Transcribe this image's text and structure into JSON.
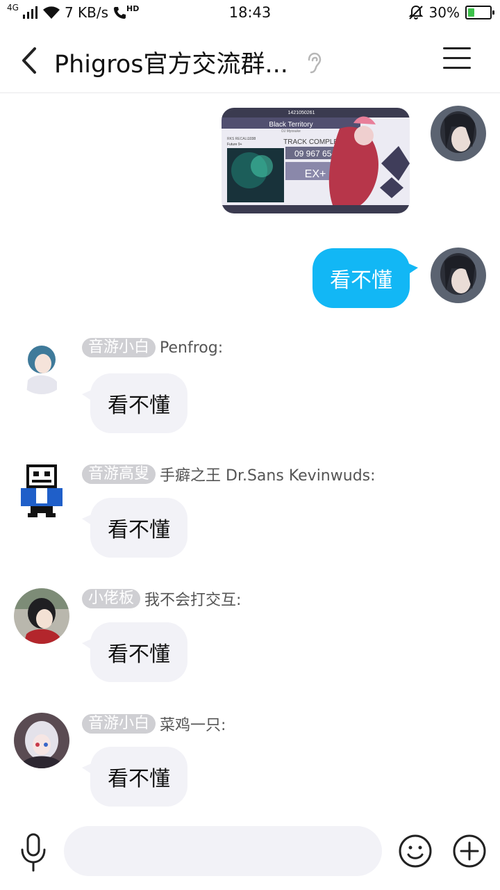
{
  "status_bar": {
    "network": "4G",
    "speed": "7 KB/s",
    "call_badge": "HD",
    "time": "18:43",
    "battery": "30%",
    "battery_level": 0.3
  },
  "header": {
    "title": "Phigros官方交流群...",
    "back_icon": "back-chevron-icon",
    "ear_icon": "earpiece-icon",
    "menu_icon": "menu-icon"
  },
  "messages": {
    "image_card": {
      "id": "1421050261",
      "song": "Black Territory",
      "artist": "DJ Myosuke",
      "track_complete": "TRACK COMPLETE",
      "score": "09 967 654",
      "grade": "EX+",
      "rks_label": "RKS RECALL",
      "rks_value": "1038",
      "difficulty": "Future 9+"
    },
    "outgoing_text": "看不懂",
    "incoming": [
      {
        "badge": "音游小白",
        "name": "Penfrog:",
        "text": "看不懂"
      },
      {
        "badge": "音游高叟",
        "name": "手癖之王 Dr.Sans Kevinwuds:",
        "text": "看不懂"
      },
      {
        "badge": "小佬板",
        "name": "我不会打交互:",
        "text": "看不懂"
      },
      {
        "badge": "音游小白",
        "name": "菜鸡一只:",
        "text": "看不懂"
      }
    ]
  },
  "input_bar": {
    "placeholder": "",
    "mic_icon": "microphone-icon",
    "emoji_icon": "emoji-icon",
    "plus_icon": "plus-icon"
  },
  "colors": {
    "accent": "#12b7f5",
    "incoming_bubble": "#f2f2f7",
    "badge": "#cfcfd3"
  }
}
